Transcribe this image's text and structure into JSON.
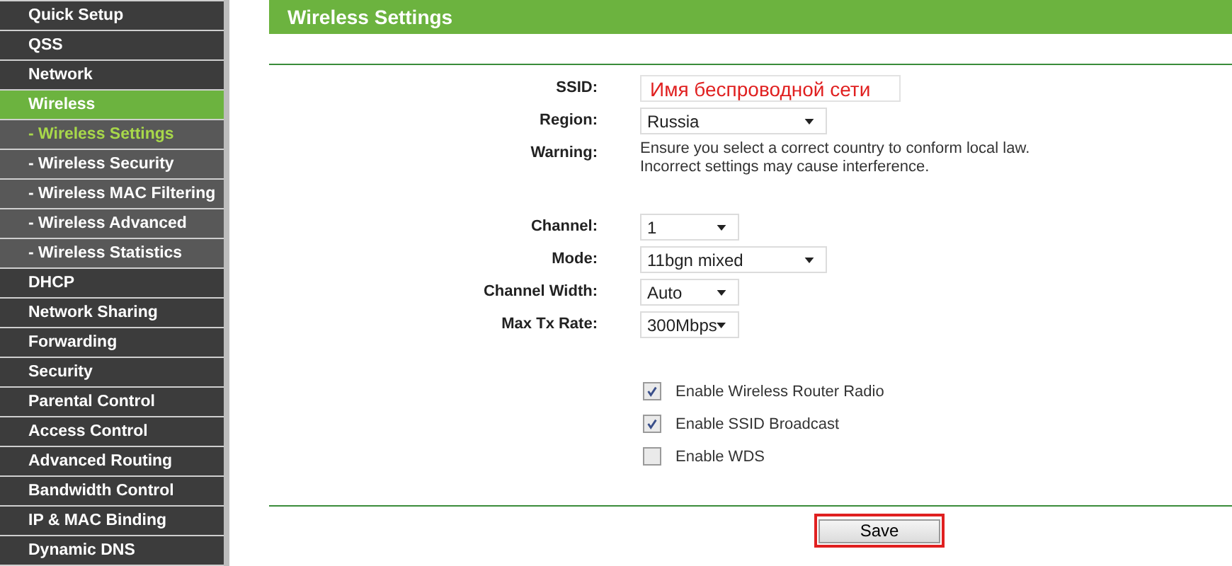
{
  "sidebar": {
    "items": [
      {
        "label": "Quick Setup",
        "selected": false
      },
      {
        "label": "QSS",
        "selected": false
      },
      {
        "label": "Network",
        "selected": false
      },
      {
        "label": "Wireless",
        "selected": true,
        "children": [
          {
            "label": "- Wireless Settings",
            "selected": true
          },
          {
            "label": "- Wireless Security",
            "selected": false
          },
          {
            "label": "- Wireless MAC Filtering",
            "selected": false
          },
          {
            "label": "- Wireless Advanced",
            "selected": false
          },
          {
            "label": "- Wireless Statistics",
            "selected": false
          }
        ]
      },
      {
        "label": "DHCP",
        "selected": false
      },
      {
        "label": "Network Sharing",
        "selected": false
      },
      {
        "label": "Forwarding",
        "selected": false
      },
      {
        "label": "Security",
        "selected": false
      },
      {
        "label": "Parental Control",
        "selected": false
      },
      {
        "label": "Access Control",
        "selected": false
      },
      {
        "label": "Advanced Routing",
        "selected": false
      },
      {
        "label": "Bandwidth Control",
        "selected": false
      },
      {
        "label": "IP & MAC Binding",
        "selected": false
      },
      {
        "label": "Dynamic DNS",
        "selected": false
      }
    ]
  },
  "page": {
    "title": "Wireless Settings",
    "fields": [
      {
        "kind": "text",
        "label": "SSID:",
        "value": "Имя беспроводной сети"
      },
      {
        "kind": "wideselect",
        "label": "Region:",
        "value": "Russia"
      },
      {
        "kind": "note",
        "label": "Warning:",
        "lines": [
          "Ensure you select a correct country to conform local law.",
          "Incorrect settings may cause interference."
        ]
      },
      {
        "kind": "gap"
      },
      {
        "kind": "select",
        "label": "Channel:",
        "value": "1"
      },
      {
        "kind": "wideselect",
        "label": "Mode:",
        "value": "11bgn mixed"
      },
      {
        "kind": "select",
        "label": "Channel Width:",
        "value": "Auto"
      },
      {
        "kind": "select",
        "label": "Max Tx Rate:",
        "value": "300Mbps"
      }
    ],
    "checkboxes": [
      {
        "label": "Enable Wireless Router Radio",
        "checked": true
      },
      {
        "label": "Enable SSID Broadcast",
        "checked": true
      },
      {
        "label": "Enable WDS",
        "checked": false
      }
    ],
    "save_button": "Save"
  }
}
